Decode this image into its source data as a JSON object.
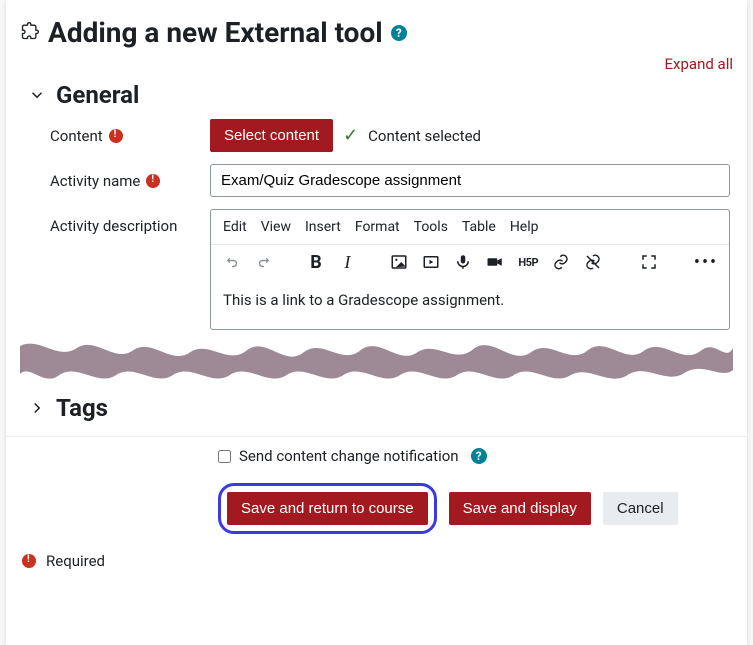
{
  "heading": "Adding a new External tool",
  "expand_all": "Expand all",
  "general": {
    "title": "General",
    "content_label": "Content",
    "select_content_btn": "Select content",
    "content_selected": "Content selected",
    "activity_name_label": "Activity name",
    "activity_name_value": "Exam/Quiz Gradescope assignment",
    "activity_description_label": "Activity description",
    "editor_menus": [
      "Edit",
      "View",
      "Insert",
      "Format",
      "Tools",
      "Table",
      "Help"
    ],
    "editor_body": "This is a link to a Gradescope assignment."
  },
  "tags": {
    "title": "Tags"
  },
  "notify_label": "Send content change notification",
  "buttons": {
    "save_return": "Save and return to course",
    "save_display": "Save and display",
    "cancel": "Cancel"
  },
  "required_label": "Required"
}
